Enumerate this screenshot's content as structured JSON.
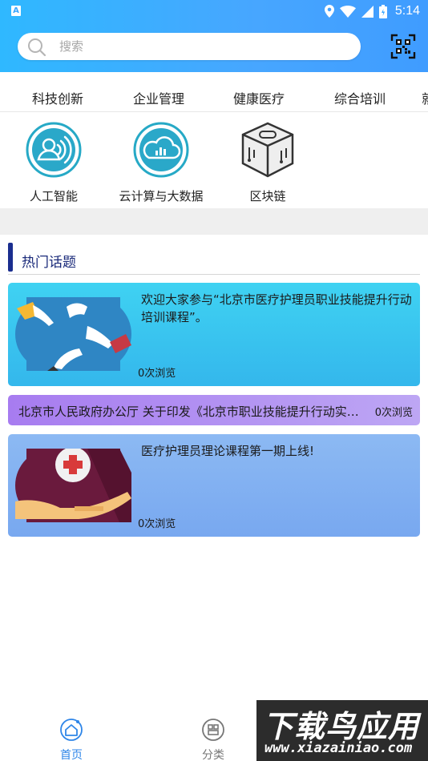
{
  "status_bar": {
    "badge": "A",
    "time": "5:14"
  },
  "search": {
    "placeholder": "搜索"
  },
  "tabs": [
    {
      "label": "科技创新"
    },
    {
      "label": "企业管理"
    },
    {
      "label": "健康医疗"
    },
    {
      "label": "综合培训"
    },
    {
      "label": "就"
    }
  ],
  "subcategories": [
    {
      "label": "人工智能",
      "icon": "ai-icon"
    },
    {
      "label": "云计算与大数据",
      "icon": "cloud-data-icon"
    },
    {
      "label": "区块链",
      "icon": "blockchain-icon"
    }
  ],
  "section": {
    "title": "热门话题"
  },
  "topics": [
    {
      "title": "欢迎大家参与“北京市医疗护理员职业技能提升行动培训课程”。",
      "views": "0次浏览"
    },
    {
      "title": "北京市人民政府办公厅 关于印发《北京市职业技能提升行动实施方案》的通知",
      "views": "0次浏览"
    },
    {
      "title": "医疗护理员理论课程第一期上线!",
      "views": "0次浏览"
    }
  ],
  "bottom_nav": [
    {
      "label": "首页",
      "icon": "home-icon"
    },
    {
      "label": "分类",
      "icon": "category-icon"
    }
  ],
  "watermark": {
    "text": "下载鸟应用",
    "url": "www.xiazainiao.com"
  },
  "colors": {
    "header_start": "#2fb8ff",
    "header_end": "#3f9cff",
    "section_bar": "#1a2e8f",
    "nav_active": "#2f86e8",
    "card_cyan": "#3fd2f2",
    "card_purple": "#a77cf0",
    "card_blue": "#8cb9f3"
  }
}
